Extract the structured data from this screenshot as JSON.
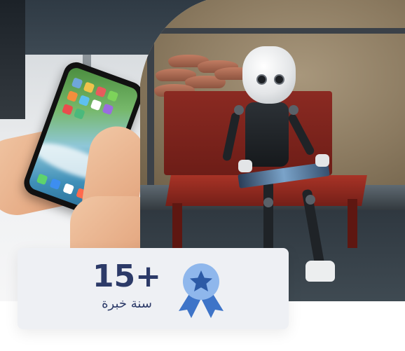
{
  "stat": {
    "number": "15+",
    "label": "سنة خبرة",
    "icon": "award-ribbon-star-icon"
  },
  "colors": {
    "card_background": "#eef0f4",
    "text_navy": "#2c3a68",
    "icon_blue": "#3e74c8",
    "icon_light_blue": "#8fb7ec"
  },
  "images": {
    "left": "photo-hands-holding-smartphone",
    "right": "photo-humanoid-robot-on-red-bench-with-tablet"
  }
}
